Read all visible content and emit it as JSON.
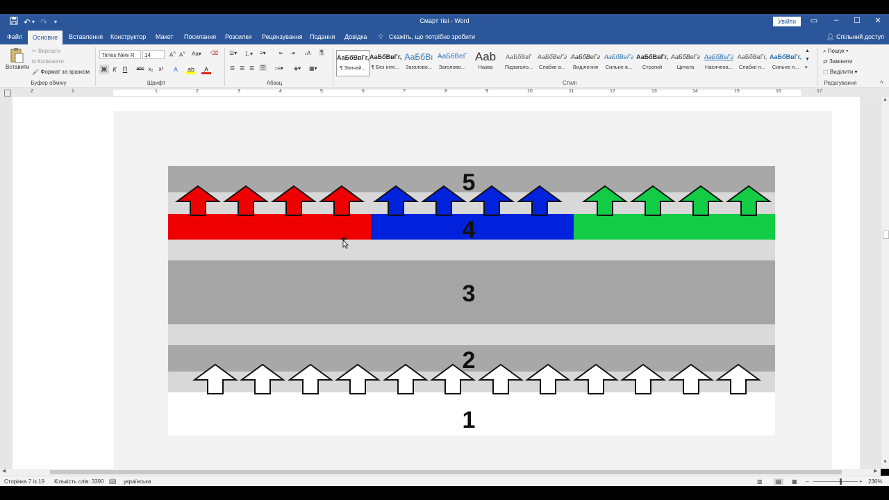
{
  "titlebar": {
    "doc_title": "Смарт тіві  -  Word",
    "signin": "Увійти"
  },
  "tabs": [
    {
      "label": "Файл"
    },
    {
      "label": "Основне"
    },
    {
      "label": "Вставлення"
    },
    {
      "label": "Конструктор"
    },
    {
      "label": "Макет"
    },
    {
      "label": "Посилання"
    },
    {
      "label": "Розсилки"
    },
    {
      "label": "Рецензування"
    },
    {
      "label": "Подання"
    },
    {
      "label": "Довідка"
    }
  ],
  "tellme": "Скажіть, що потрібно зробити",
  "share": "Спільний доступ",
  "ribbon": {
    "clipboard": {
      "paste": "Вставити",
      "cut": "Вирізати",
      "copy": "Копіювати",
      "format_painter": "Формат за зразком",
      "label": "Буфер обміну"
    },
    "font": {
      "name": "Times New R",
      "size": "14",
      "label": "Шрифт",
      "bold": "Ж",
      "italic": "К",
      "underline": "П"
    },
    "paragraph": {
      "label": "Абзац"
    },
    "styles": {
      "label": "Стилі",
      "items": [
        {
          "sample": "АаБбВвГг,",
          "name": "¶ Звичай..."
        },
        {
          "sample": "АаБбВвГг,",
          "name": "¶ Без інте..."
        },
        {
          "sample": "АаБбВı",
          "name": "Заголово..."
        },
        {
          "sample": "АаБбВеГ",
          "name": "Заголово..."
        },
        {
          "sample": "Aab",
          "name": "Назва"
        },
        {
          "sample": "АаБбВвГ",
          "name": "Підзаголо..."
        },
        {
          "sample": "АаБбВеГг",
          "name": "Слабке в..."
        },
        {
          "sample": "АаБбВеГг",
          "name": "Виділення"
        },
        {
          "sample": "АаБбВеГг",
          "name": "Сильне в..."
        },
        {
          "sample": "АаБбВвГг,",
          "name": "Строгий"
        },
        {
          "sample": "АаБбВеГг",
          "name": "Цитата"
        },
        {
          "sample": "АаБбВеГг",
          "name": "Насичена..."
        },
        {
          "sample": "АаБбВвГг,",
          "name": "Слабке п..."
        },
        {
          "sample": "АаБбВвГг,",
          "name": "Сильне п..."
        }
      ]
    },
    "editing": {
      "find": "Пошук",
      "replace": "Замінити",
      "select": "Виділити",
      "label": "Редагування"
    }
  },
  "ruler": {
    "numbers": [
      "2",
      "1",
      "1",
      "2",
      "3",
      "4",
      "5",
      "6",
      "7",
      "8",
      "9",
      "10",
      "11",
      "12",
      "13",
      "14",
      "15",
      "16",
      "17"
    ]
  },
  "diagram": {
    "layers": [
      {
        "label": "5"
      },
      {
        "label": "4"
      },
      {
        "label": "3"
      },
      {
        "label": "2"
      },
      {
        "label": "1"
      }
    ],
    "colors": {
      "red": "#ee0000",
      "blue": "#0022dd",
      "green": "#11cc44",
      "gray_dark": "#a8a8a8",
      "gray_light": "#d8d8d8",
      "gray_mid": "#a5a5a5"
    }
  },
  "statusbar": {
    "page": "Сторінка 7 із 19",
    "words": "Кількість слів: 3390",
    "language": "українська",
    "zoom": "236%"
  }
}
